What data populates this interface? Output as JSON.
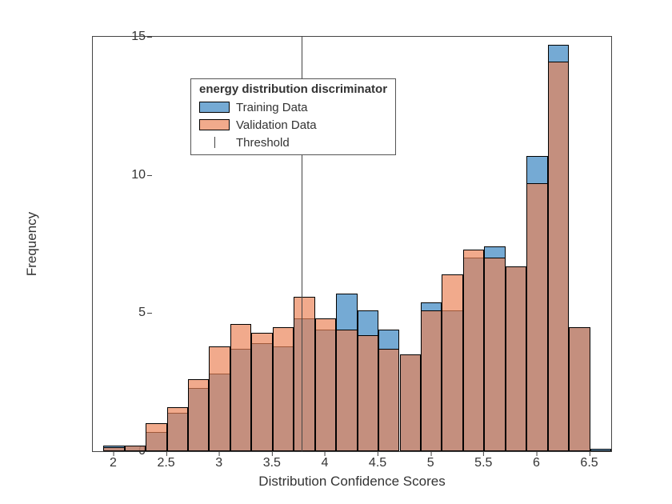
{
  "chart_data": {
    "type": "bar",
    "title": "energy distribution discriminator",
    "xlabel": "Distribution Confidence Scores",
    "ylabel": "Frequency",
    "xlim": [
      1.8,
      6.7
    ],
    "ylim": [
      0,
      15
    ],
    "x_ticks": [
      2,
      2.5,
      3,
      3.5,
      4,
      4.5,
      5,
      5.5,
      6,
      6.5
    ],
    "y_ticks": [
      0,
      5,
      10,
      15
    ],
    "bin_width": 0.2,
    "bin_edges": [
      1.9,
      2.1,
      2.3,
      2.5,
      2.7,
      2.9,
      3.1,
      3.3,
      3.5,
      3.7,
      3.9,
      4.1,
      4.3,
      4.5,
      4.7,
      4.9,
      5.1,
      5.3,
      5.5,
      5.7,
      5.9,
      6.1,
      6.3,
      6.5,
      6.7
    ],
    "series": [
      {
        "name": "Training Data",
        "color": "#3382c0",
        "opacity": 0.68,
        "values": [
          0.2,
          0.2,
          0.7,
          1.4,
          2.3,
          2.8,
          3.7,
          3.9,
          3.8,
          4.8,
          4.4,
          5.7,
          5.1,
          4.4,
          3.5,
          5.4,
          5.1,
          7.0,
          7.4,
          6.7,
          10.7,
          14.7,
          4.5,
          0.1
        ]
      },
      {
        "name": "Validation Data",
        "color": "#ea8256",
        "opacity": 0.68,
        "values": [
          0.15,
          0.2,
          1.0,
          1.6,
          2.6,
          3.8,
          4.6,
          4.3,
          4.5,
          5.6,
          4.8,
          4.4,
          4.2,
          3.7,
          3.5,
          5.1,
          6.4,
          7.3,
          7.0,
          6.7,
          9.7,
          14.1,
          4.5,
          0.0
        ]
      }
    ],
    "threshold": 3.77,
    "legend": {
      "title": "energy distribution discriminator",
      "entries": [
        "Training Data",
        "Validation Data",
        "Threshold"
      ]
    }
  },
  "colors": {
    "training": "#3382c0",
    "validation": "#ea8256",
    "axis": "#444444"
  }
}
